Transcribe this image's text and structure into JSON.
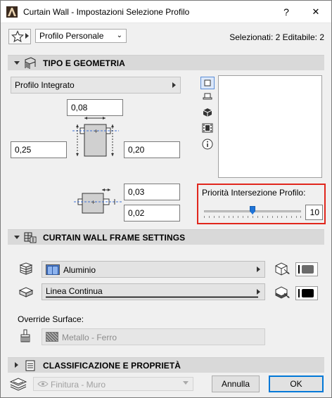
{
  "window": {
    "title": "Curtain Wall - Impostazioni Selezione Profilo",
    "help_label": "?",
    "close_label": "✕"
  },
  "toolbar": {
    "profile_value": "Profilo Personale",
    "selection_info": "Selezionati: 2 Editabile: 2"
  },
  "sections": {
    "geometry": "TIPO E GEOMETRIA",
    "frame": "CURTAIN WALL FRAME SETTINGS",
    "classification": "CLASSIFICAZIONE E PROPRIETÀ"
  },
  "geometry": {
    "profile_type": "Profilo Integrato",
    "depth": "0,08",
    "offset_left": "0,25",
    "offset_right": "0,20",
    "gap_top": "0,03",
    "gap_bottom": "0,02"
  },
  "priority": {
    "label": "Priorità Intersezione Profilo:",
    "value": "10",
    "slider_fraction": 0.5
  },
  "frame": {
    "material": "Aluminio",
    "line_type": "Linea Continua",
    "material_pen_color": "#6b6b6b",
    "line_pen_color": "#000000"
  },
  "surface": {
    "override_label": "Override Surface:",
    "value": "Metallo - Ferro"
  },
  "footer": {
    "layer": "Finitura - Muro",
    "cancel_label": "Annulla",
    "ok_label": "OK"
  },
  "icons": {
    "favorites": "star-icon",
    "geometry_section": "profile-geometry-icon",
    "frame_section": "frame-settings-icon",
    "classification_section": "classification-icon",
    "layer": "layers-icon",
    "view_options": [
      "plan-view-icon",
      "section-view-icon",
      "3d-view-icon",
      "film-strip-icon",
      "info-icon"
    ]
  }
}
